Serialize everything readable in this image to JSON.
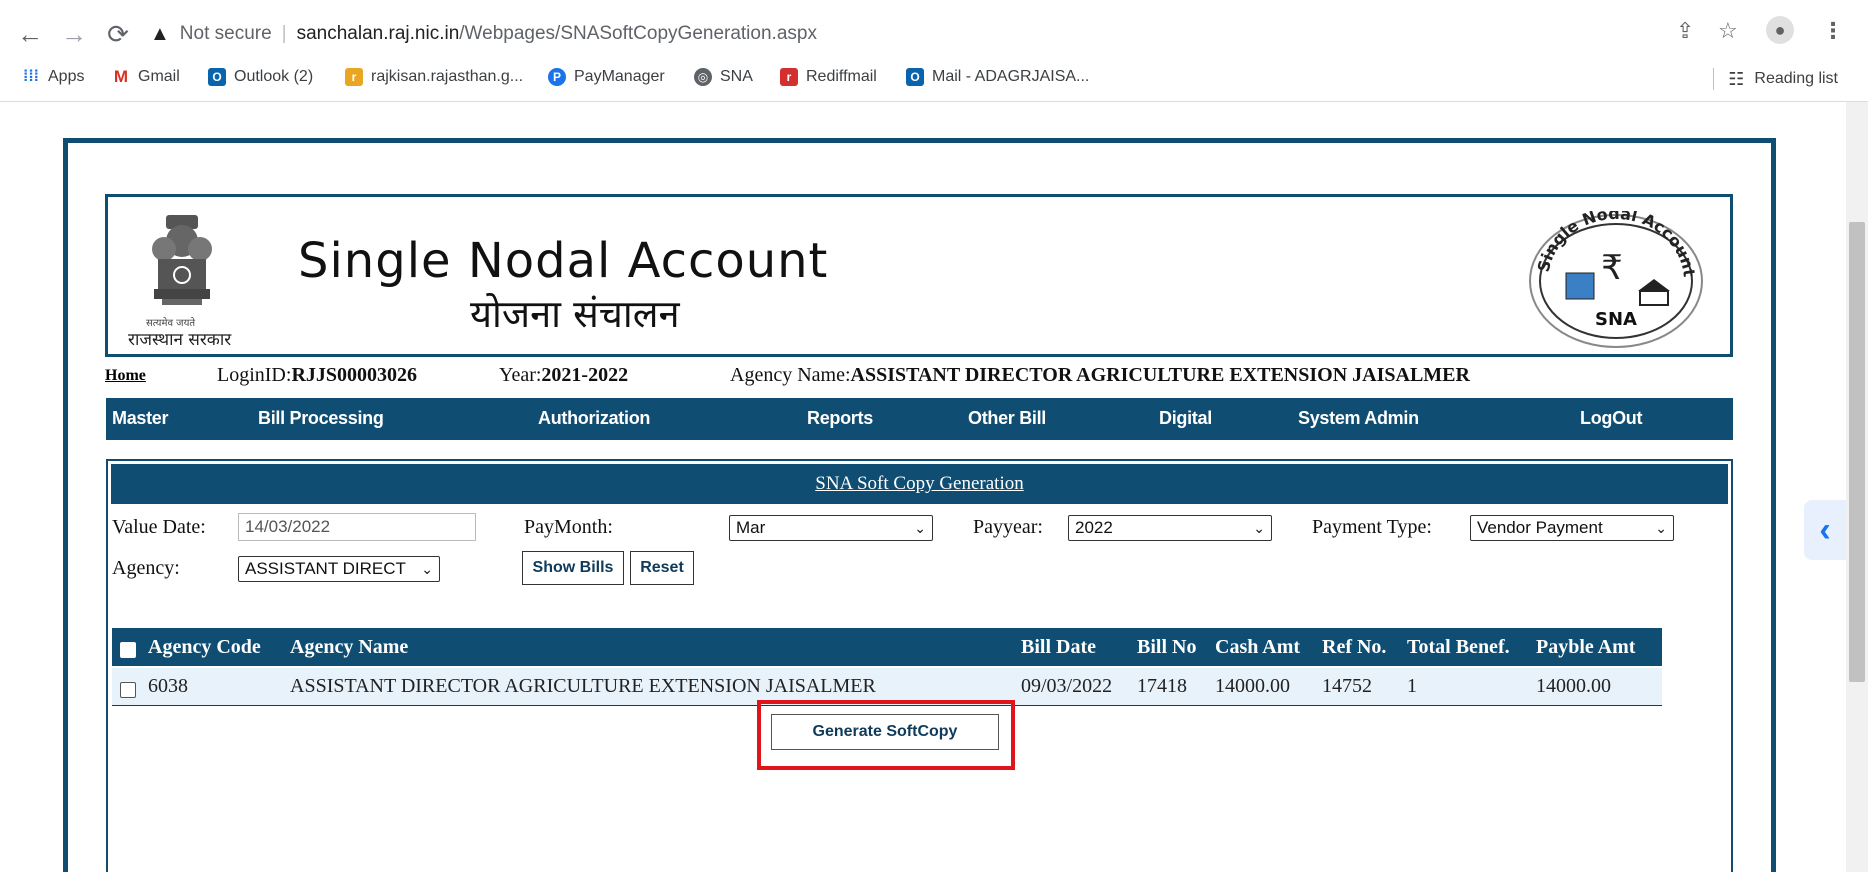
{
  "browser": {
    "not_secure": "Not secure",
    "url_host": "sanchalan.raj.nic.in",
    "url_path": "/Webpages/SNASoftCopyGeneration.aspx",
    "bookmarks": [
      "Apps",
      "Gmail",
      "Outlook (2)",
      "rajkisan.rajasthan.g...",
      "PayManager",
      "SNA",
      "Rediffmail",
      "Mail - ADAGRJAISA..."
    ],
    "reading_list": "Reading list"
  },
  "header": {
    "title_en": "Single Nodal Account",
    "title_hi": "योजना संचालन",
    "emblem_caption": "राजस्थान सरकार",
    "emblem_motto": "सत्यमेव जयते",
    "logo_text": "SNA",
    "logo_ring": "Single Nodal Account",
    "logo_currency": "₹"
  },
  "info": {
    "home": "Home",
    "login_label": "LoginID:",
    "login_value": "RJJS00003026",
    "year_label": "Year:",
    "year_value": "2021-2022",
    "agency_label": "Agency Name:",
    "agency_value": "ASSISTANT DIRECTOR AGRICULTURE EXTENSION JAISALMER"
  },
  "menu": [
    "Master",
    "Bill Processing",
    "Authorization",
    "Reports",
    "Other Bill",
    "Digital",
    "System Admin",
    "LogOut"
  ],
  "form": {
    "title": "SNA Soft Copy Generation",
    "value_date_label": "Value Date:",
    "value_date": "14/03/2022",
    "paymonth_label": "PayMonth:",
    "paymonth": "Mar",
    "payyear_label": "Payyear:",
    "payyear": "2022",
    "payment_type_label": "Payment Type:",
    "payment_type": "Vendor Payment",
    "agency_label": "Agency:",
    "agency": "ASSISTANT DIRECT",
    "show_bills": "Show Bills",
    "reset": "Reset"
  },
  "grid": {
    "headers": [
      "Agency Code",
      "Agency Name",
      "Bill Date",
      "Bill No",
      "Cash Amt",
      "Ref No.",
      "Total Benef.",
      "Payble Amt"
    ],
    "rows": [
      [
        "6038",
        "ASSISTANT DIRECTOR AGRICULTURE EXTENSION JAISALMER",
        "09/03/2022",
        "17418",
        "14000.00",
        "14752",
        "1",
        "14000.00"
      ]
    ]
  },
  "generate_button": "Generate SoftCopy",
  "colors": {
    "brand": "#0f4d73",
    "highlight": "#e0141b"
  }
}
